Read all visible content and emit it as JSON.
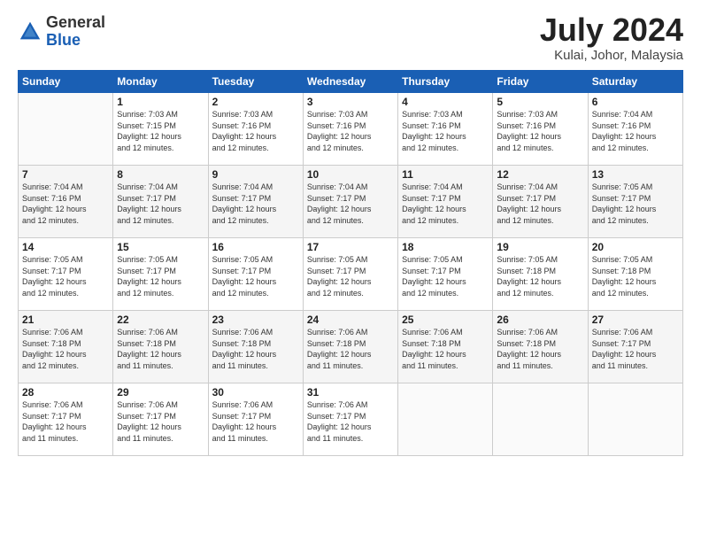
{
  "header": {
    "logo": {
      "general": "General",
      "blue": "Blue"
    },
    "title": "July 2024",
    "location": "Kulai, Johor, Malaysia"
  },
  "calendar": {
    "weekdays": [
      "Sunday",
      "Monday",
      "Tuesday",
      "Wednesday",
      "Thursday",
      "Friday",
      "Saturday"
    ],
    "weeks": [
      [
        {
          "day": "",
          "sunrise": "",
          "sunset": "",
          "daylight": ""
        },
        {
          "day": "1",
          "sunrise": "Sunrise: 7:03 AM",
          "sunset": "Sunset: 7:15 PM",
          "daylight": "Daylight: 12 hours and 12 minutes."
        },
        {
          "day": "2",
          "sunrise": "Sunrise: 7:03 AM",
          "sunset": "Sunset: 7:16 PM",
          "daylight": "Daylight: 12 hours and 12 minutes."
        },
        {
          "day": "3",
          "sunrise": "Sunrise: 7:03 AM",
          "sunset": "Sunset: 7:16 PM",
          "daylight": "Daylight: 12 hours and 12 minutes."
        },
        {
          "day": "4",
          "sunrise": "Sunrise: 7:03 AM",
          "sunset": "Sunset: 7:16 PM",
          "daylight": "Daylight: 12 hours and 12 minutes."
        },
        {
          "day": "5",
          "sunrise": "Sunrise: 7:03 AM",
          "sunset": "Sunset: 7:16 PM",
          "daylight": "Daylight: 12 hours and 12 minutes."
        },
        {
          "day": "6",
          "sunrise": "Sunrise: 7:04 AM",
          "sunset": "Sunset: 7:16 PM",
          "daylight": "Daylight: 12 hours and 12 minutes."
        }
      ],
      [
        {
          "day": "7",
          "sunrise": "Sunrise: 7:04 AM",
          "sunset": "Sunset: 7:16 PM",
          "daylight": "Daylight: 12 hours and 12 minutes."
        },
        {
          "day": "8",
          "sunrise": "Sunrise: 7:04 AM",
          "sunset": "Sunset: 7:17 PM",
          "daylight": "Daylight: 12 hours and 12 minutes."
        },
        {
          "day": "9",
          "sunrise": "Sunrise: 7:04 AM",
          "sunset": "Sunset: 7:17 PM",
          "daylight": "Daylight: 12 hours and 12 minutes."
        },
        {
          "day": "10",
          "sunrise": "Sunrise: 7:04 AM",
          "sunset": "Sunset: 7:17 PM",
          "daylight": "Daylight: 12 hours and 12 minutes."
        },
        {
          "day": "11",
          "sunrise": "Sunrise: 7:04 AM",
          "sunset": "Sunset: 7:17 PM",
          "daylight": "Daylight: 12 hours and 12 minutes."
        },
        {
          "day": "12",
          "sunrise": "Sunrise: 7:04 AM",
          "sunset": "Sunset: 7:17 PM",
          "daylight": "Daylight: 12 hours and 12 minutes."
        },
        {
          "day": "13",
          "sunrise": "Sunrise: 7:05 AM",
          "sunset": "Sunset: 7:17 PM",
          "daylight": "Daylight: 12 hours and 12 minutes."
        }
      ],
      [
        {
          "day": "14",
          "sunrise": "Sunrise: 7:05 AM",
          "sunset": "Sunset: 7:17 PM",
          "daylight": "Daylight: 12 hours and 12 minutes."
        },
        {
          "day": "15",
          "sunrise": "Sunrise: 7:05 AM",
          "sunset": "Sunset: 7:17 PM",
          "daylight": "Daylight: 12 hours and 12 minutes."
        },
        {
          "day": "16",
          "sunrise": "Sunrise: 7:05 AM",
          "sunset": "Sunset: 7:17 PM",
          "daylight": "Daylight: 12 hours and 12 minutes."
        },
        {
          "day": "17",
          "sunrise": "Sunrise: 7:05 AM",
          "sunset": "Sunset: 7:17 PM",
          "daylight": "Daylight: 12 hours and 12 minutes."
        },
        {
          "day": "18",
          "sunrise": "Sunrise: 7:05 AM",
          "sunset": "Sunset: 7:17 PM",
          "daylight": "Daylight: 12 hours and 12 minutes."
        },
        {
          "day": "19",
          "sunrise": "Sunrise: 7:05 AM",
          "sunset": "Sunset: 7:18 PM",
          "daylight": "Daylight: 12 hours and 12 minutes."
        },
        {
          "day": "20",
          "sunrise": "Sunrise: 7:05 AM",
          "sunset": "Sunset: 7:18 PM",
          "daylight": "Daylight: 12 hours and 12 minutes."
        }
      ],
      [
        {
          "day": "21",
          "sunrise": "Sunrise: 7:06 AM",
          "sunset": "Sunset: 7:18 PM",
          "daylight": "Daylight: 12 hours and 12 minutes."
        },
        {
          "day": "22",
          "sunrise": "Sunrise: 7:06 AM",
          "sunset": "Sunset: 7:18 PM",
          "daylight": "Daylight: 12 hours and 11 minutes."
        },
        {
          "day": "23",
          "sunrise": "Sunrise: 7:06 AM",
          "sunset": "Sunset: 7:18 PM",
          "daylight": "Daylight: 12 hours and 11 minutes."
        },
        {
          "day": "24",
          "sunrise": "Sunrise: 7:06 AM",
          "sunset": "Sunset: 7:18 PM",
          "daylight": "Daylight: 12 hours and 11 minutes."
        },
        {
          "day": "25",
          "sunrise": "Sunrise: 7:06 AM",
          "sunset": "Sunset: 7:18 PM",
          "daylight": "Daylight: 12 hours and 11 minutes."
        },
        {
          "day": "26",
          "sunrise": "Sunrise: 7:06 AM",
          "sunset": "Sunset: 7:18 PM",
          "daylight": "Daylight: 12 hours and 11 minutes."
        },
        {
          "day": "27",
          "sunrise": "Sunrise: 7:06 AM",
          "sunset": "Sunset: 7:17 PM",
          "daylight": "Daylight: 12 hours and 11 minutes."
        }
      ],
      [
        {
          "day": "28",
          "sunrise": "Sunrise: 7:06 AM",
          "sunset": "Sunset: 7:17 PM",
          "daylight": "Daylight: 12 hours and 11 minutes."
        },
        {
          "day": "29",
          "sunrise": "Sunrise: 7:06 AM",
          "sunset": "Sunset: 7:17 PM",
          "daylight": "Daylight: 12 hours and 11 minutes."
        },
        {
          "day": "30",
          "sunrise": "Sunrise: 7:06 AM",
          "sunset": "Sunset: 7:17 PM",
          "daylight": "Daylight: 12 hours and 11 minutes."
        },
        {
          "day": "31",
          "sunrise": "Sunrise: 7:06 AM",
          "sunset": "Sunset: 7:17 PM",
          "daylight": "Daylight: 12 hours and 11 minutes."
        },
        {
          "day": "",
          "sunrise": "",
          "sunset": "",
          "daylight": ""
        },
        {
          "day": "",
          "sunrise": "",
          "sunset": "",
          "daylight": ""
        },
        {
          "day": "",
          "sunrise": "",
          "sunset": "",
          "daylight": ""
        }
      ]
    ]
  }
}
